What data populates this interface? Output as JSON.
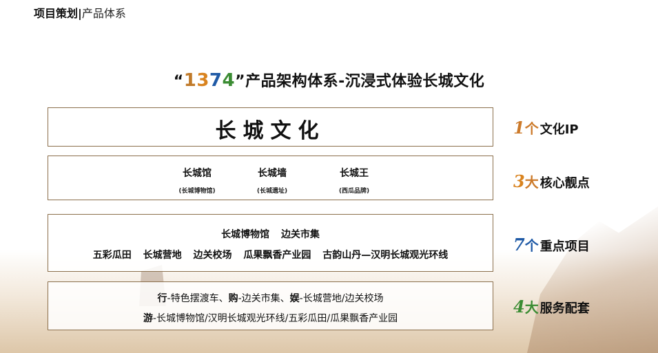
{
  "header": {
    "title": "项目策划",
    "separator": "|",
    "subtitle": "产品体系"
  },
  "main_title": {
    "open_quote": "“",
    "digits": [
      {
        "text": "1",
        "color": "#c07a2a"
      },
      {
        "text": "3",
        "color": "#d9831f"
      },
      {
        "text": "7",
        "color": "#1f5aa6"
      },
      {
        "text": "4",
        "color": "#3b8c33"
      }
    ],
    "close_quote": "”",
    "text": "产品架构体系-沉浸式体验长城文化"
  },
  "tier1": {
    "text": "长城文化"
  },
  "tier2": {
    "items": [
      {
        "label": "长城馆",
        "sub": "(长城博物馆)"
      },
      {
        "label": "长城墙",
        "sub": "(长城遗址)"
      },
      {
        "label": "长城王",
        "sub": "(西瓜品牌)"
      }
    ]
  },
  "tier3": {
    "row1": [
      "长城博物馆",
      "边关市集"
    ],
    "row2": [
      "五彩瓜田",
      "长城营地",
      "边关校场",
      "瓜果飘香产业园",
      "古韵山丹—汉明长城观光环线"
    ]
  },
  "tier4": {
    "row1": [
      {
        "key": "行",
        "value": "-特色摆渡车、"
      },
      {
        "key": "购",
        "value": "-边关市集、"
      },
      {
        "key": "娱",
        "value": "-长城营地/边关校场"
      }
    ],
    "row2": [
      {
        "key": "游",
        "value": "-长城博物馆/汉明长城观光环线/五彩瓜田/瓜果飘香产业园"
      }
    ]
  },
  "side_labels": [
    {
      "num": "1",
      "unit": "个",
      "text": "文化IP",
      "color": "#cc7a2a"
    },
    {
      "num": "3",
      "unit": "大",
      "text": "核心靓点",
      "color": "#d9831f"
    },
    {
      "num": "7",
      "unit": "个",
      "text": "重点项目",
      "color": "#1f5aa6"
    },
    {
      "num": "4",
      "unit": "大",
      "text": "服务配套",
      "color": "#3b8c33"
    }
  ]
}
